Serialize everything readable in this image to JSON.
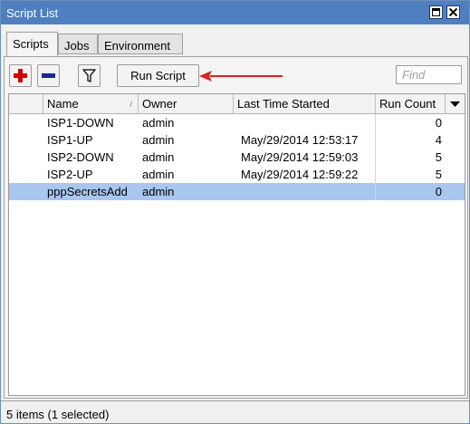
{
  "window": {
    "title": "Script List"
  },
  "tabs": [
    {
      "label": "Scripts",
      "active": true
    },
    {
      "label": "Jobs",
      "active": false
    },
    {
      "label": "Environment",
      "active": false
    }
  ],
  "toolbar": {
    "add_icon": "plus-icon",
    "remove_icon": "minus-icon",
    "filter_icon": "filter-icon",
    "run_label": "Run Script",
    "find_placeholder": "Find",
    "arrow_color": "#e02020"
  },
  "table": {
    "columns": [
      "Name",
      "Owner",
      "Last Time Started",
      "Run Count"
    ],
    "rows": [
      {
        "name": "ISP1-DOWN",
        "owner": "admin",
        "last": "",
        "count": "0",
        "selected": false
      },
      {
        "name": "ISP1-UP",
        "owner": "admin",
        "last": "May/29/2014 12:53:17",
        "count": "4",
        "selected": false
      },
      {
        "name": "ISP2-DOWN",
        "owner": "admin",
        "last": "May/29/2014 12:59:03",
        "count": "5",
        "selected": false
      },
      {
        "name": "ISP2-UP",
        "owner": "admin",
        "last": "May/29/2014 12:59:22",
        "count": "5",
        "selected": false
      },
      {
        "name": "pppSecretsAdd",
        "owner": "admin",
        "last": "",
        "count": "0",
        "selected": true
      }
    ]
  },
  "status": {
    "text": "5 items (1 selected)"
  },
  "colors": {
    "titlebar": "#4f7fc0",
    "selected_row": "#a8c6ee"
  }
}
